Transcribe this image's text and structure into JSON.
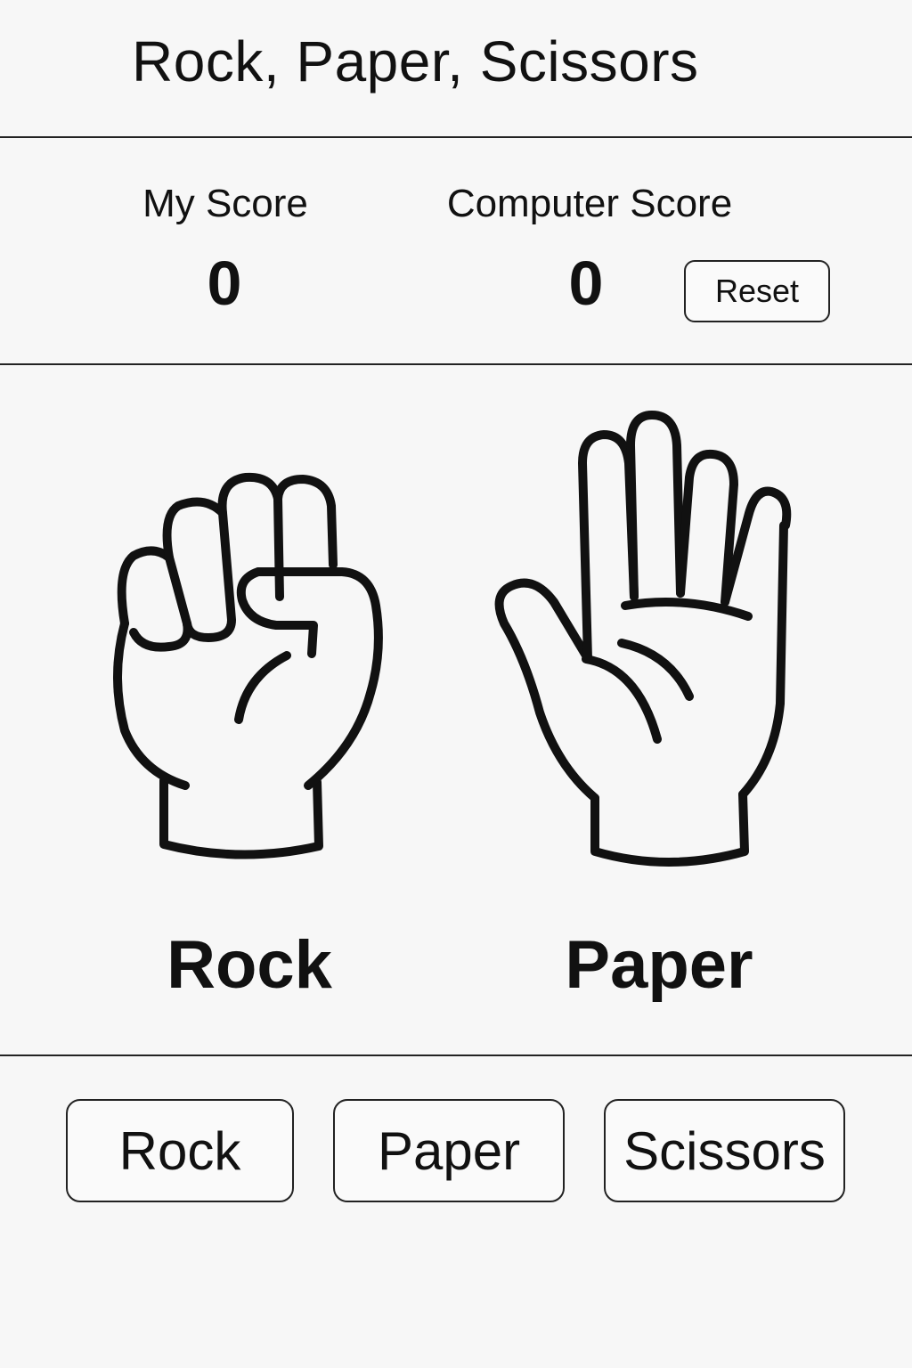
{
  "app": {
    "title": "Rock, Paper, Scissors"
  },
  "scoreboard": {
    "my_score_label": "My Score",
    "my_score_value": "0",
    "computer_score_label": "Computer Score",
    "computer_score_value": "0",
    "reset_label": "Reset"
  },
  "play_area": {
    "my_choice": {
      "icon": "fist-hand-icon",
      "label": "Rock"
    },
    "computer_choice": {
      "icon": "open-hand-icon",
      "label": "Paper"
    }
  },
  "controls": {
    "rock_label": "Rock",
    "paper_label": "Paper",
    "scissors_label": "Scissors"
  },
  "colors": {
    "background": "#f7f7f7",
    "stroke": "#111111"
  }
}
